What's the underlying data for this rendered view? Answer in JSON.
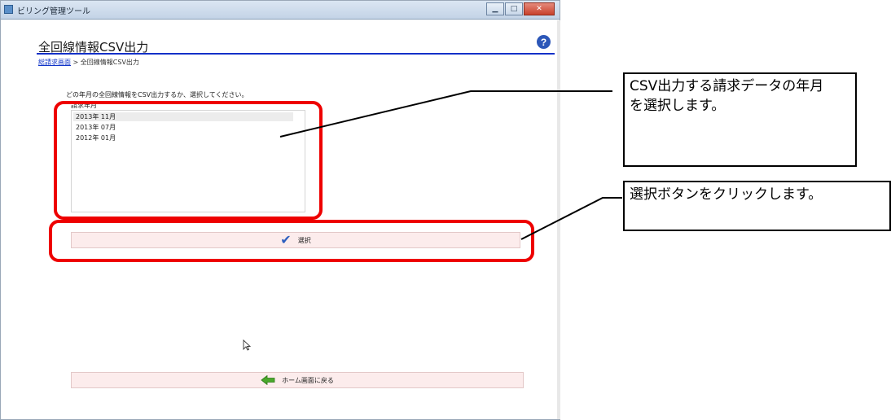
{
  "window": {
    "title": "ビリング管理ツール",
    "minimize": "▁",
    "maximize": "□",
    "close": "✕"
  },
  "page": {
    "title": "全回線情報CSV出力",
    "help": "?",
    "breadcrumb": {
      "link": "総請求画面",
      "separator": " > ",
      "current": "全回線情報CSV出力"
    },
    "instruction": "どの年月の全回線情報をCSV出力するか、選択してください。",
    "list_label": "請求年月",
    "months": [
      "2013年 11月",
      "2013年 07月",
      "2012年 01月"
    ],
    "selected_month": "2013年 11月",
    "select_button": "選択",
    "home_button": "ホーム画面に戻る"
  },
  "annotations": {
    "callout_1": "CSV出力する請求データの年月を選択します。",
    "callout_2": "選択ボタンをクリックします。",
    "highlight_color": "#ee0000"
  },
  "icons": {
    "check": "check-icon",
    "home_arrow": "left-arrow-icon",
    "help": "question-icon",
    "cursor": "mouse-cursor-icon"
  }
}
